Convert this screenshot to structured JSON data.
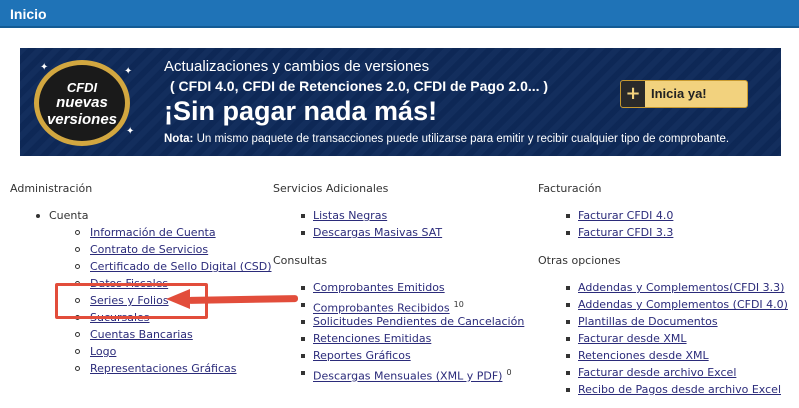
{
  "header": {
    "title": "Inicio"
  },
  "banner": {
    "badge_line1": "CFDI",
    "badge_line2": "nuevas",
    "badge_line3": "versiones",
    "line1": "Actualizaciones y cambios de versiones",
    "line2": "( CFDI 4.0, CFDI de Retenciones 2.0, CFDI de Pago 2.0... )",
    "line3": "¡Sin pagar nada más!",
    "note_label": "Nota:",
    "note_text": " Un mismo paquete de transacciones puede utilizarse para emitir y recibir cualquier tipo de comprobante.",
    "cta_plus": "+",
    "cta_label": "Inicia ya!"
  },
  "admin": {
    "heading": "Administración",
    "group": "Cuenta",
    "items": [
      "Información de Cuenta",
      "Contrato de Servicios",
      "Certificado de Sello Digital (CSD)",
      "Datos Fiscales",
      "Series y Folios",
      "Sucursales",
      "Cuentas Bancarias",
      "Logo",
      "Representaciones Gráficas"
    ]
  },
  "servicios": {
    "heading": "Servicios Adicionales",
    "items": [
      "Listas Negras",
      "Descargas Masivas SAT"
    ]
  },
  "consultas": {
    "heading": "Consultas",
    "items": [
      "Comprobantes Emitidos",
      "Comprobantes Recibidos",
      "Solicitudes Pendientes de Cancelación",
      "Retenciones Emitidas",
      "Reportes Gráficos",
      "Descargas Mensuales (XML y PDF)"
    ],
    "recibidos_count": "10",
    "mensuales_count": "0"
  },
  "facturacion": {
    "heading": "Facturación",
    "items": [
      "Facturar CFDI 4.0",
      "Facturar CFDI 3.3"
    ]
  },
  "otras": {
    "heading": "Otras opciones",
    "items": [
      "Addendas y Complementos(CFDI 3.3)",
      "Addendas y Complementos (CFDI 4.0)",
      "Plantillas de Documentos",
      "Facturar desde XML",
      "Retenciones desde XML",
      "Facturar desde archivo Excel",
      "Recibo de Pagos desde archivo Excel"
    ]
  },
  "colors": {
    "header_bg": "#1f73b7",
    "banner_bg": "#0e2a5a",
    "highlight": "#e24d3b",
    "cta_bg": "#f2d27e"
  }
}
